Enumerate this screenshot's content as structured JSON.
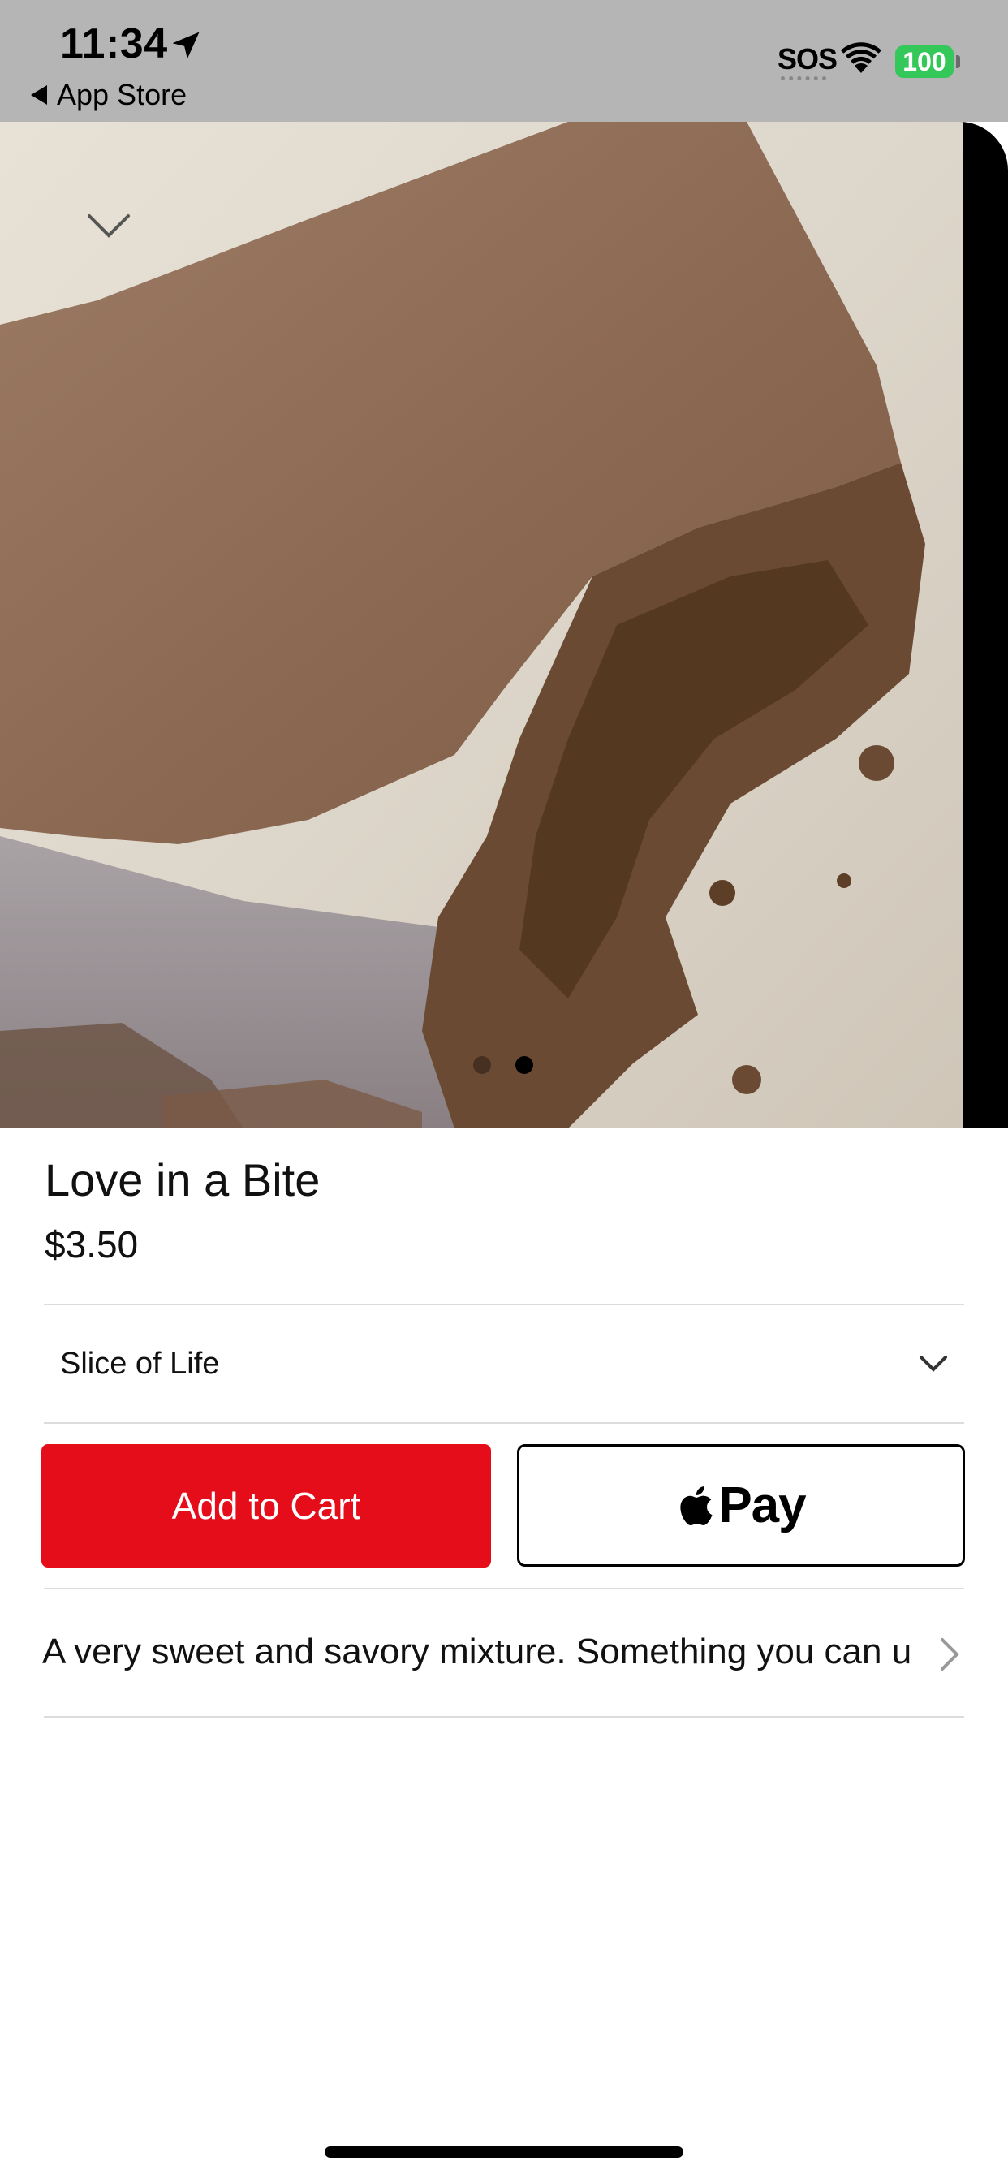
{
  "status_bar": {
    "time": "11:34",
    "back_label": "App Store",
    "sos": "SOS",
    "battery": "100"
  },
  "hero": {
    "image_alt": "chocolate brownie with frosting",
    "page_count": 2,
    "active_page": 2
  },
  "product": {
    "title": "Love in a Bite",
    "price": "$3.50",
    "variant": "Slice of Life",
    "description": "A very sweet and savory mixture. Something you can u"
  },
  "actions": {
    "add_to_cart": "Add to Cart",
    "apple_pay": "Pay"
  },
  "colors": {
    "status_bar_bg": "#b5b5b5",
    "add_to_cart_bg": "#e50d1a",
    "battery_green": "#34c759"
  }
}
